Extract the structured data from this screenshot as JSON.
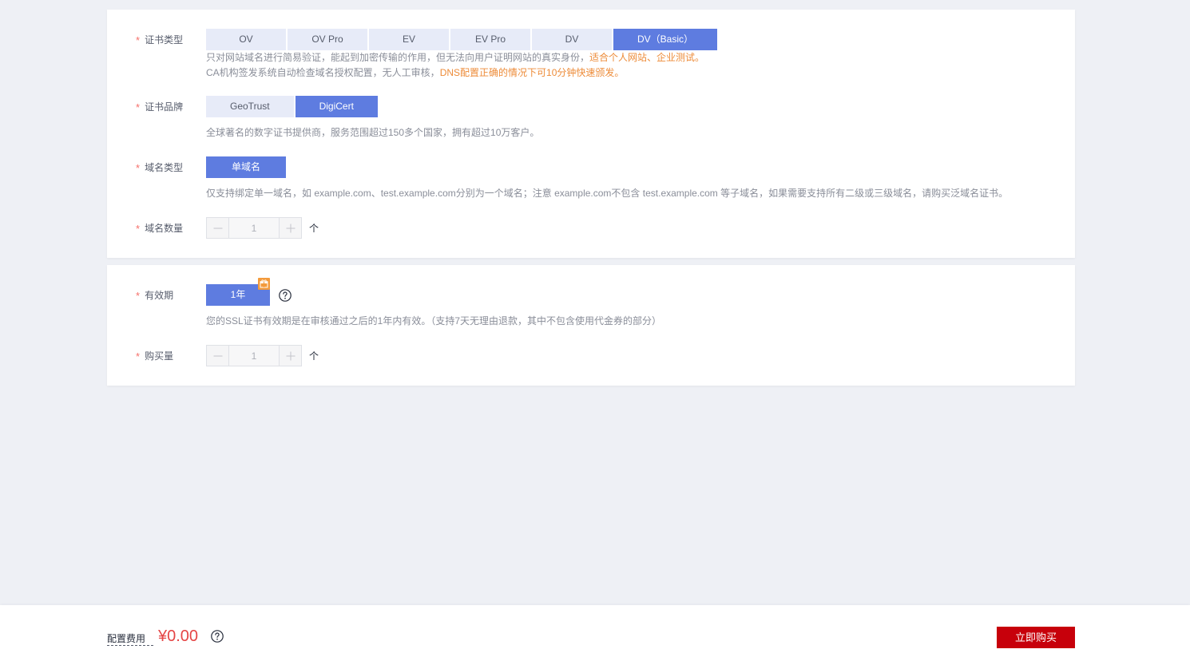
{
  "required_mark": "*",
  "cert_type": {
    "label": "证书类型",
    "options": [
      {
        "label": "OV",
        "selected": false
      },
      {
        "label": "OV Pro",
        "selected": false
      },
      {
        "label": "EV",
        "selected": false
      },
      {
        "label": "EV Pro",
        "selected": false
      },
      {
        "label": "DV",
        "selected": false
      },
      {
        "label": "DV（Basic）",
        "selected": true
      }
    ],
    "desc": [
      {
        "text": "只对网站域名进行简易验证，能起到加密传输的作用，但无法向用户证明网站的真实身份，",
        "highlight": "适合个人网站、企业测试。"
      },
      {
        "text": "CA机构签发系统自动检查域名授权配置，无人工审核，",
        "highlight": "DNS配置正确的情况下可10分钟快速颁发。"
      }
    ]
  },
  "cert_brand": {
    "label": "证书品牌",
    "options": [
      {
        "label": "GeoTrust",
        "selected": false
      },
      {
        "label": "DigiCert",
        "selected": true
      }
    ],
    "desc": "全球著名的数字证书提供商，服务范围超过150多个国家，拥有超过10万客户。"
  },
  "domain_type": {
    "label": "域名类型",
    "options": [
      {
        "label": "单域名",
        "selected": true
      }
    ],
    "desc": "仅支持绑定单一域名，如 example.com、test.example.com分别为一个域名；注意 example.com不包含 test.example.com 等子域名，如果需要支持所有二级或三级域名，请购买泛域名证书。"
  },
  "domain_count": {
    "label": "域名数量",
    "value": "1",
    "unit": "个"
  },
  "validity": {
    "label": "有效期",
    "options": [
      {
        "label": "1年",
        "selected": true
      }
    ],
    "desc": "您的SSL证书有效期是在审核通过之后的1年内有效。（支持7天无理由退款，其中不包含使用代金券的部分）"
  },
  "purchase_qty": {
    "label": "购买量",
    "value": "1",
    "unit": "个"
  },
  "footer": {
    "fee_label": "配置费用",
    "price": "¥0.00",
    "buy_label": "立即购买"
  },
  "colors": {
    "primary": "#5e7ce0",
    "highlight": "#ed8b38",
    "price": "#e54545",
    "buy": "#c7000b",
    "required": "#f66f6a"
  }
}
